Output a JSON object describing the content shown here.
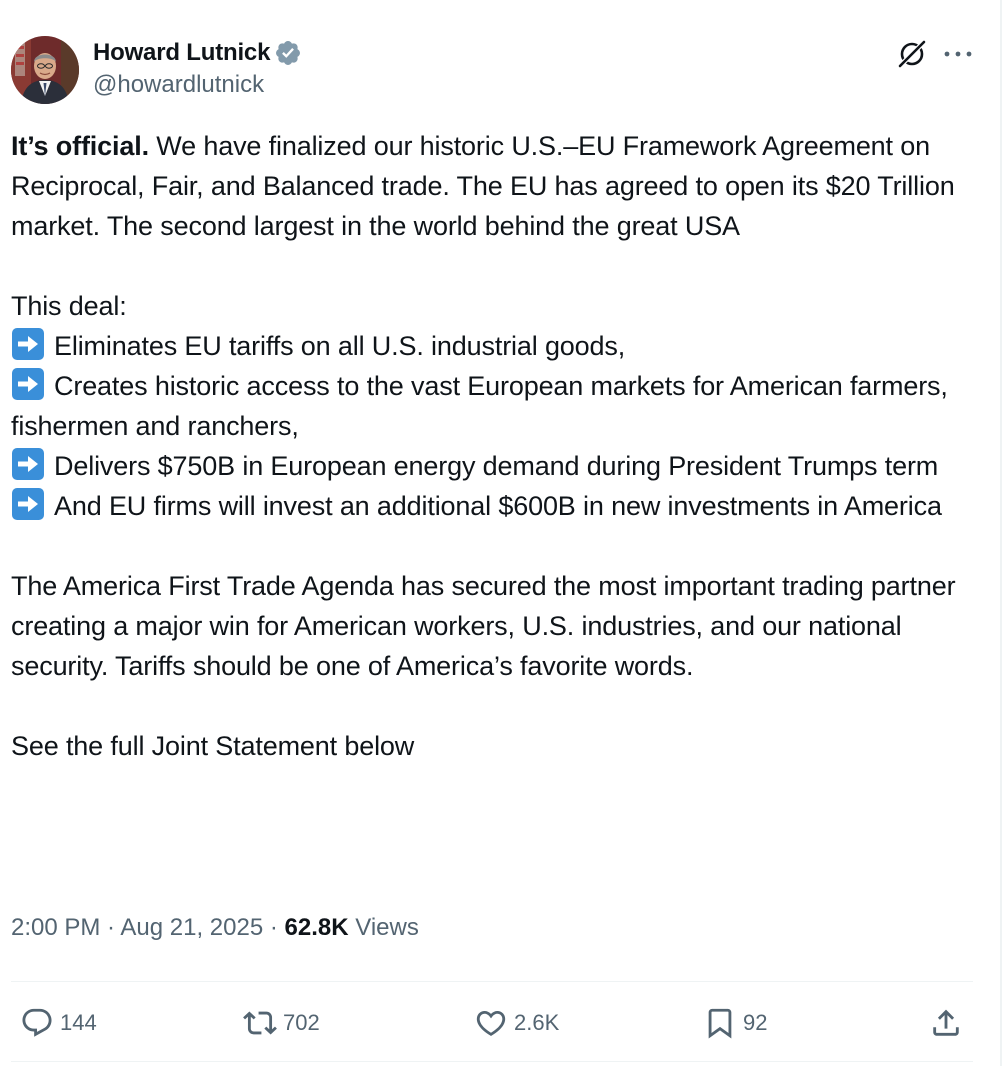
{
  "author": {
    "display_name": "Howard Lutnick",
    "handle": "@howardlutnick",
    "verified": true
  },
  "post": {
    "lead_bold": "It’s official.",
    "lead_rest": " We have finalized our historic U.S.–EU Framework Agreement on Reciprocal, Fair, and Balanced trade. The EU has agreed to open its $20 Trillion market. The second largest in the world behind the great USA",
    "deal_intro": "This deal:",
    "bullets": [
      "Eliminates EU tariffs on all U.S. industrial goods,",
      "Creates historic access to the vast European markets for American farmers, fishermen and ranchers,",
      "Delivers $750B in European energy demand during President Trumps term",
      "And EU firms will invest an additional $600B in new investments in America"
    ],
    "closing": "The America First Trade Agenda has secured the most important trading partner creating a major win for American workers, U.S. industries, and our national security. Tariffs should be one of America’s favorite words.",
    "see_more": "See the full Joint Statement below"
  },
  "meta": {
    "time": "2:00 PM",
    "separator": " · ",
    "date": "Aug 21, 2025",
    "views_count": "62.8K",
    "views_label": " Views"
  },
  "actions": {
    "replies": "144",
    "reposts": "702",
    "likes": "2.6K",
    "bookmarks": "92"
  },
  "icons": {
    "verified": "verified-badge-icon",
    "grok": "grok-icon",
    "more": "more-dots-icon",
    "bullet": "right-arrow-emoji",
    "reply": "reply-icon",
    "repost": "repost-icon",
    "like": "heart-icon",
    "bookmark": "bookmark-icon",
    "share": "share-icon"
  },
  "colors": {
    "text_primary": "#0f1419",
    "text_secondary": "#536471",
    "verified_badge": "#829aab",
    "emoji_blue": "#3a8fd9",
    "divider": "#eff3f4"
  }
}
